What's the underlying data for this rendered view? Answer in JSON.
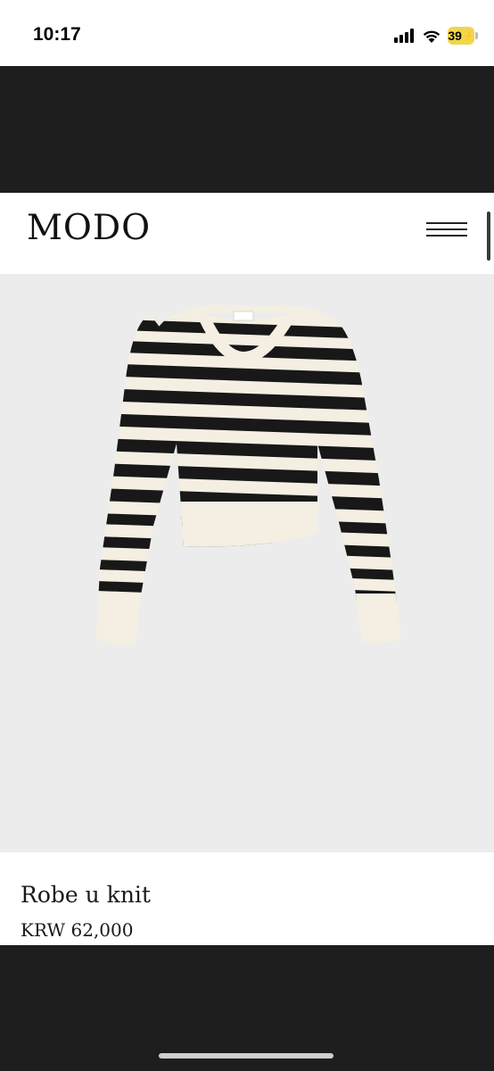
{
  "status_bar": {
    "time": "10:17",
    "battery_level": "39",
    "icons": [
      "cellular-signal-icon",
      "wifi-icon",
      "battery-charging-icon"
    ],
    "battery_color": "#f1d64b"
  },
  "header": {
    "logo": "MODO",
    "menu_icon": "hamburger-menu-icon"
  },
  "product": {
    "image": "striped-sweater-image",
    "image_background": "#ececec",
    "name": "Robe u knit",
    "price": "KRW 62,000"
  },
  "colors": {
    "page_dark": "#1e1e1e",
    "stripe_black": "#181818",
    "stripe_cream": "#f4efe2"
  }
}
